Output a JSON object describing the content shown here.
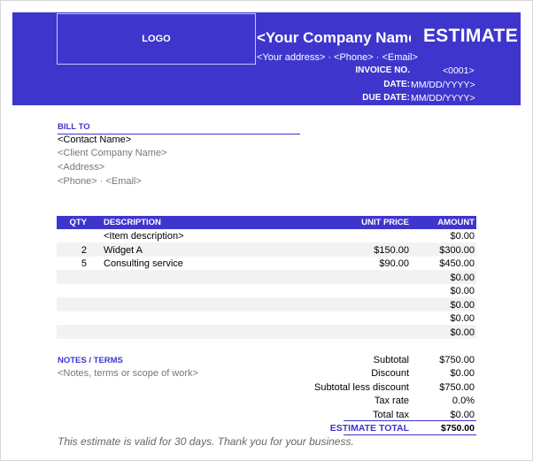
{
  "header": {
    "logo": "LOGO",
    "company_name": "<Your Company Name>",
    "doc_title": "ESTIMATE",
    "contact": "<Your address>  ·  <Phone>  ·  <Email>",
    "invoice_no_label": "INVOICE NO.",
    "invoice_no": "<0001>",
    "date_label": "DATE:",
    "date": "MM/DD/YYYY>",
    "due_label": "DUE DATE:",
    "due_date": "MM/DD/YYYY>"
  },
  "bill_to": {
    "label": "BILL TO",
    "contact_name": "<Contact Name>",
    "client_company": "<Client Company Name>",
    "address": "<Address>",
    "phone_email": "<Phone>  ·  <Email>"
  },
  "table": {
    "headers": {
      "qty": "QTY",
      "description": "DESCRIPTION",
      "unit_price": "UNIT PRICE",
      "amount": "AMOUNT"
    },
    "rows": [
      {
        "qty": "",
        "description": "<Item description>",
        "unit_price": "",
        "amount": "$0.00"
      },
      {
        "qty": "2",
        "description": "Widget A",
        "unit_price": "$150.00",
        "amount": "$300.00"
      },
      {
        "qty": "5",
        "description": "Consulting service",
        "unit_price": "$90.00",
        "amount": "$450.00"
      },
      {
        "qty": "",
        "description": "",
        "unit_price": "",
        "amount": "$0.00"
      },
      {
        "qty": "",
        "description": "",
        "unit_price": "",
        "amount": "$0.00"
      },
      {
        "qty": "",
        "description": "",
        "unit_price": "",
        "amount": "$0.00"
      },
      {
        "qty": "",
        "description": "",
        "unit_price": "",
        "amount": "$0.00"
      },
      {
        "qty": "",
        "description": "",
        "unit_price": "",
        "amount": "$0.00"
      }
    ]
  },
  "notes": {
    "label": "NOTES / TERMS",
    "text": "<Notes, terms or scope of work>"
  },
  "totals": {
    "subtotal_label": "Subtotal",
    "subtotal": "$750.00",
    "discount_label": "Discount",
    "discount": "$0.00",
    "less_discount_label": "Subtotal less discount",
    "less_discount": "$750.00",
    "tax_rate_label": "Tax rate",
    "tax_rate": "0.0%",
    "total_tax_label": "Total tax",
    "total_tax": "$0.00",
    "grand_label": "ESTIMATE TOTAL",
    "grand": "$750.00"
  },
  "footer": "This estimate is valid for 30 days.  Thank you for your business.",
  "colors": {
    "accent": "#3e36cc",
    "row_alt": "#f2f2f2"
  }
}
